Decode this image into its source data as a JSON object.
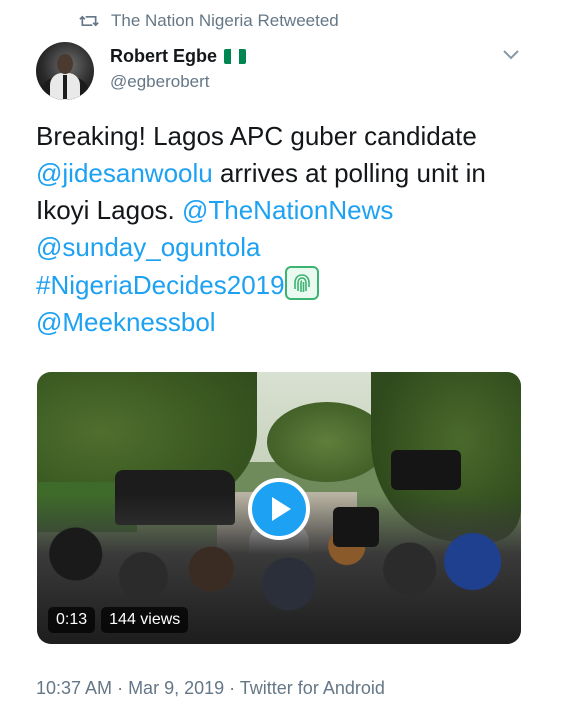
{
  "retweet": {
    "label": "The Nation Nigeria Retweeted",
    "icon": "retweet-icon"
  },
  "author": {
    "display_name": "Robert Egbe",
    "handle": "@egberobert",
    "flag_colors": [
      "#008751",
      "#ffffff",
      "#008751"
    ]
  },
  "tweet": {
    "segments": [
      {
        "text": "Breaking! Lagos APC guber candidate ",
        "type": "text"
      },
      {
        "text": "@jidesanwoolu",
        "type": "link"
      },
      {
        "text": " arrives at polling unit in Ikoyi Lagos. ",
        "type": "text"
      },
      {
        "text": "@TheNationNews",
        "type": "link"
      },
      {
        "text": "@sunday_oguntola",
        "type": "link"
      },
      {
        "text": "#NigeriaDecides2019",
        "type": "link"
      },
      {
        "text": "@Meeknessbol",
        "type": "link"
      }
    ],
    "emoji": "fingerprint-emoji"
  },
  "media": {
    "duration": "0:13",
    "views": "144 views",
    "play_icon": "play-icon"
  },
  "meta": {
    "time": "10:37 AM",
    "date": "Mar 9, 2019",
    "source": "Twitter for Android",
    "separator": " · "
  },
  "colors": {
    "link": "#1da1f2",
    "secondary": "#657786",
    "text": "#14171a"
  }
}
